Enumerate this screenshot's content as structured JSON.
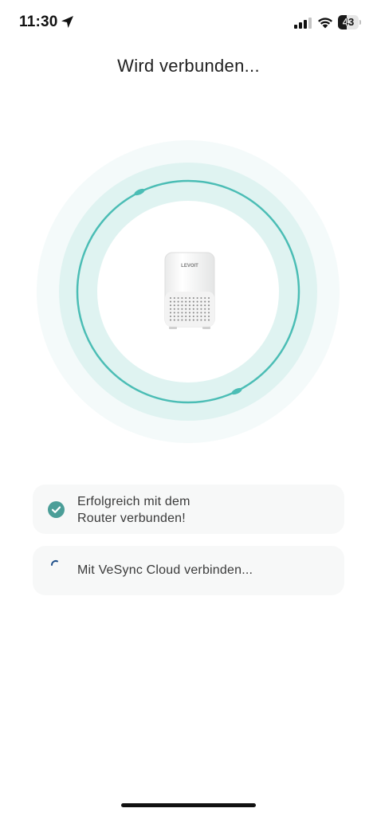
{
  "status_bar": {
    "time": "11:30",
    "battery_level": "43",
    "battery_fraction": 0.43
  },
  "page": {
    "title": "Wird verbunden..."
  },
  "device": {
    "brand": "LEVOIT"
  },
  "steps": [
    {
      "text": "Erfolgreich mit dem Router verbunden!",
      "state": "done"
    },
    {
      "text": "Mit VeSync Cloud verbinden...",
      "state": "in-progress"
    }
  ],
  "colors": {
    "accent": "#4bbdb5",
    "ring_inner": "#dff3f1",
    "ring_outer": "#f4fafa",
    "card_bg": "#f7f8f8"
  },
  "icons": {
    "location": "location-arrow-icon",
    "signal": "cellular-signal-icon",
    "wifi": "wifi-icon",
    "battery": "battery-icon",
    "check": "check-circle-icon",
    "spinner": "loading-spinner-icon"
  }
}
